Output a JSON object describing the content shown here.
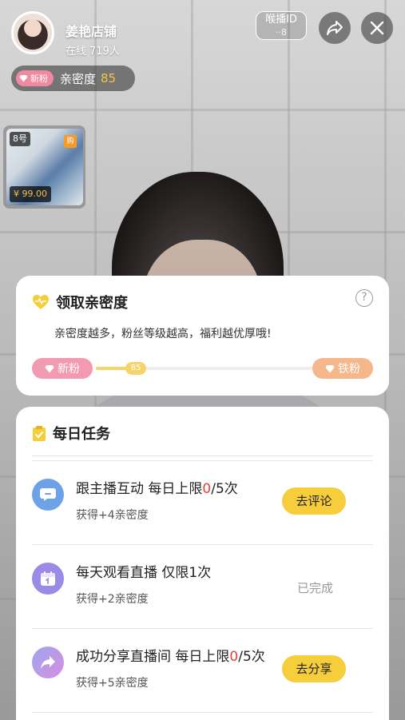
{
  "host": {
    "name": "姜艳店铺",
    "online_label": "在线",
    "online_count": "719人"
  },
  "top_bar": {
    "id_label": "喉播ID",
    "id_value": "··8"
  },
  "intimacy_pill": {
    "badge": "新粉",
    "label": "亲密度",
    "value": "85"
  },
  "product": {
    "number": "8号",
    "tag": "购",
    "price": "¥ 99.00"
  },
  "intimacy_card": {
    "title": "领取亲密度",
    "help": "?",
    "description": "亲密度越多，粉丝等级越高，福利越优厚哦!",
    "level_from": "新粉",
    "level_to": "铁粉",
    "progress_value": "85",
    "progress_fraction": 0.18
  },
  "tasks_card": {
    "title": "每日任务",
    "tasks": [
      {
        "title_pre": "跟主播互动  每日上限",
        "title_count": "0",
        "title_post": "/5次",
        "reward": "获得+4亲密度",
        "action": "去评论",
        "icon": "comment-icon",
        "color": "#6ea2e8"
      },
      {
        "title_pre": "每天观看直播  仅限1次",
        "title_count": "",
        "title_post": "",
        "reward": "获得+2亲密度",
        "status": "已完成",
        "icon": "calendar-icon",
        "color": "#9b8ae6"
      },
      {
        "title_pre": "成功分享直播间  每日上限",
        "title_count": "0",
        "title_post": "/5次",
        "reward": "获得+5亲密度",
        "action": "去分享",
        "icon": "share-icon",
        "color": "#c68ee6"
      }
    ]
  },
  "colors": {
    "accent_yellow": "#f6ce3b",
    "badge_pink": "#f29ab0",
    "badge_orange": "#f5b88c",
    "highlight_red": "#e8403a"
  }
}
